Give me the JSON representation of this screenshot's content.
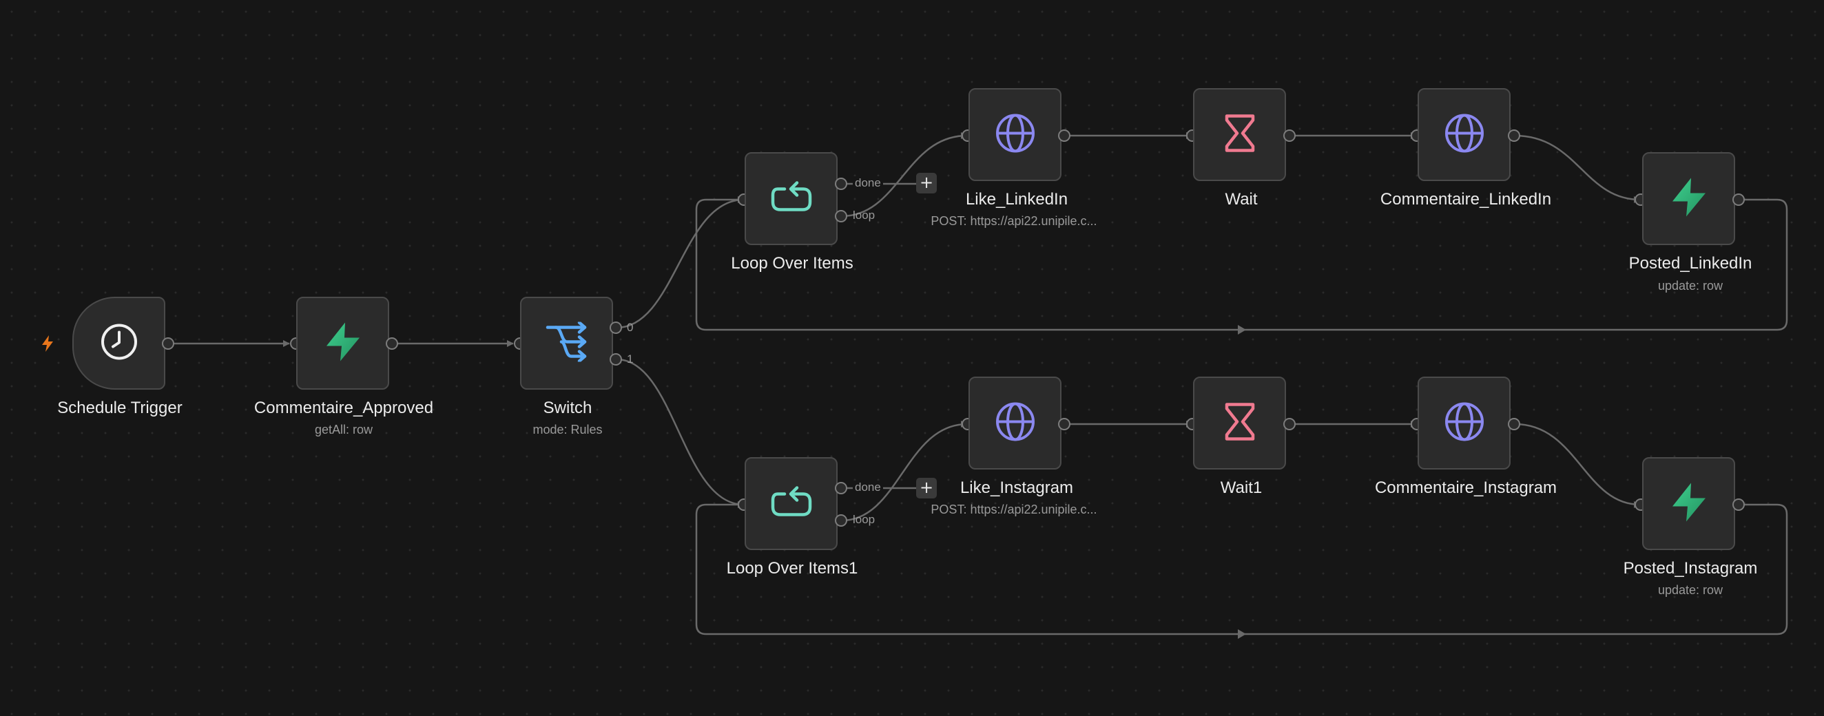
{
  "workflow": {
    "nodes": {
      "schedule_trigger": {
        "label": "Schedule Trigger",
        "icon": "clock-icon"
      },
      "commentaire_approved": {
        "label": "Commentaire_Approved",
        "sub": "getAll: row",
        "icon": "supabase-icon"
      },
      "switch": {
        "label": "Switch",
        "sub": "mode: Rules",
        "icon": "switch-icon",
        "outputs": [
          "0",
          "1"
        ]
      },
      "loop_over_items": {
        "label": "Loop Over Items",
        "icon": "loop-icon",
        "outputs": [
          "done",
          "loop"
        ]
      },
      "loop_over_items1": {
        "label": "Loop Over Items1",
        "icon": "loop-icon",
        "outputs": [
          "done",
          "loop"
        ]
      },
      "like_linkedin": {
        "label": "Like_LinkedIn",
        "sub": "POST: https://api22.unipile.c...",
        "icon": "globe-icon"
      },
      "like_instagram": {
        "label": "Like_Instagram",
        "sub": "POST: https://api22.unipile.c...",
        "icon": "globe-icon"
      },
      "wait": {
        "label": "Wait",
        "icon": "hourglass-icon"
      },
      "wait1": {
        "label": "Wait1",
        "icon": "hourglass-icon"
      },
      "commentaire_linkedin": {
        "label": "Commentaire_LinkedIn",
        "icon": "globe-icon"
      },
      "commentaire_instagram": {
        "label": "Commentaire_Instagram",
        "icon": "globe-icon"
      },
      "posted_linkedin": {
        "label": "Posted_LinkedIn",
        "sub": "update: row",
        "icon": "supabase-icon"
      },
      "posted_instagram": {
        "label": "Posted_Instagram",
        "sub": "update: row",
        "icon": "supabase-icon"
      }
    },
    "add_button_label": "+"
  },
  "colors": {
    "background": "#161616",
    "node_fill": "#2b2b2b",
    "node_border": "#4a4a4a",
    "edge": "#6a6a6a",
    "trigger_bolt": "#e8761c",
    "supabase_green": "#3ecf8e",
    "globe": "#8b88f0",
    "hourglass": "#f07a90",
    "loop": "#6fdcc4",
    "switch": "#5aa9f5"
  }
}
